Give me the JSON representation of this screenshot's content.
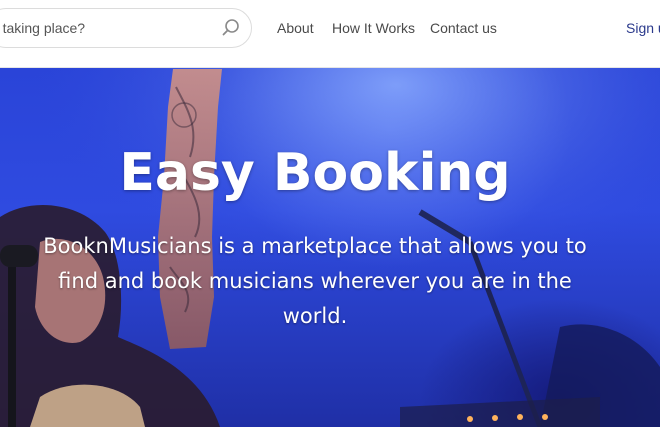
{
  "header": {
    "search": {
      "placeholder": "nt taking place?"
    },
    "nav": {
      "about": "About",
      "how_it_works": "How It Works",
      "contact": "Contact us"
    },
    "signup": "Sign u"
  },
  "hero": {
    "title": "Easy Booking",
    "subtitle": "BooknMusicians is a marketplace that allows you to find and book musicians wherever you are in the world."
  },
  "colors": {
    "hero_blue": "#2f4be0",
    "nav_text": "#4a4a4a",
    "signup_text": "#2b3a8c"
  },
  "icons": {
    "search": "search-icon"
  }
}
